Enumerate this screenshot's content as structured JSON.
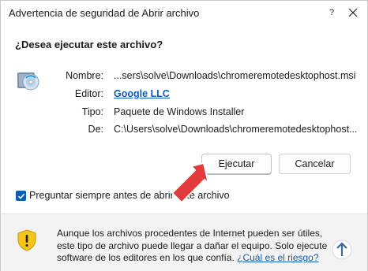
{
  "window": {
    "title": "Advertencia de seguridad de Abrir archivo"
  },
  "dialog": {
    "question": "¿Desea ejecutar este archivo?",
    "fields": {
      "name_label": "Nombre:",
      "name_value": "...sers\\solve\\Downloads\\chromeremotedesktophost.msi",
      "publisher_label": "Editor:",
      "publisher_value": "Google LLC",
      "type_label": "Tipo:",
      "type_value": "Paquete de Windows Installer",
      "from_label": "De:",
      "from_value": "C:\\Users\\solve\\Downloads\\chromeremotedesktophost..."
    },
    "buttons": {
      "run": "Ejecutar",
      "cancel": "Cancelar"
    },
    "checkbox": {
      "label": "Preguntar siempre antes de abrir este archivo",
      "checked": true
    },
    "warning": {
      "text": "Aunque los archivos procedentes de Internet pueden ser útiles, este tipo de archivo puede llegar a dañar el equipo. Solo ejecute software de los editores en los que confía. ",
      "link": "¿Cuál es el riesgo?"
    }
  },
  "icons": {
    "help": "help-icon",
    "close": "close-icon",
    "file": "installer-disc-icon",
    "shield": "shield-warning-icon",
    "arrow": "red-pointer-arrow-icon"
  },
  "colors": {
    "accent": "#0f5bb5",
    "checkbox": "#0c5eb4",
    "arrow": "#e23b3b",
    "shield": "#f5c518"
  }
}
